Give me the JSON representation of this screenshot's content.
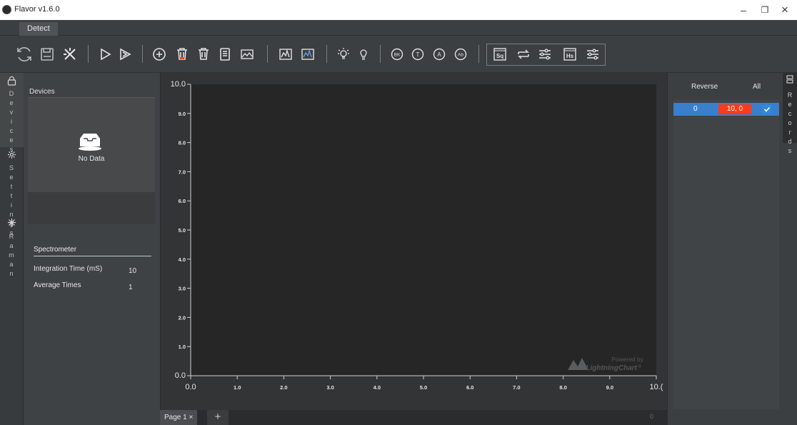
{
  "window": {
    "title": "Flavor v1.6.0",
    "minimize_glyph": "–",
    "restore_glyph": "❐",
    "close_glyph": "×"
  },
  "menu": {
    "tabs": [
      {
        "label": "Detect"
      }
    ]
  },
  "toolbar": {
    "icons": [
      "refresh-icon",
      "save-icon",
      "tools-icon",
      "play-icon",
      "play-outline-icon",
      "add-circle-icon",
      "delete-red-icon",
      "delete-icon",
      "document-icon",
      "image-icon",
      "spectrum-icon",
      "spectrum-filled-icon",
      "light-on-icon",
      "light-off-icon",
      "bk-icon",
      "t-icon",
      "a-icon",
      "ab-icon",
      "sq-icon",
      "swap-icon",
      "sliders-icon",
      "hs-icon",
      "sliders-icon-2"
    ],
    "badges": {
      "bk": "BK",
      "t": "T",
      "a": "A",
      "ab": "Ab",
      "sq": "Sq",
      "hs": "Hs"
    }
  },
  "left_tabs": [
    {
      "label": "Devices",
      "icon": "lock-icon"
    },
    {
      "label": "Settings",
      "icon": "gear-icon"
    },
    {
      "label": "Raman",
      "icon": "starburst-icon"
    }
  ],
  "devices": {
    "label": "Devices",
    "empty_text": "No Data"
  },
  "spectrometer": {
    "title": "Spectrometer",
    "rows": [
      {
        "label": "Integration Time  (mS)",
        "value": "10"
      },
      {
        "label": "Average Times",
        "value": "1"
      }
    ]
  },
  "chart_data": {
    "type": "line",
    "x": [],
    "series": [],
    "xlim": [
      0.0,
      10.0
    ],
    "ylim": [
      0.0,
      10.0
    ],
    "x_ticks": [
      "0.0",
      "1.0",
      "2.0",
      "3.0",
      "4.0",
      "5.0",
      "6.0",
      "7.0",
      "8.0",
      "9.0",
      "10.("
    ],
    "y_ticks": [
      "0.0",
      "1.0",
      "2.0",
      "3.0",
      "4.0",
      "5.0",
      "6.0",
      "7.0",
      "8.0",
      "9.0",
      "10.0"
    ],
    "grid": false,
    "watermark_line1": "Powered by",
    "watermark_line2": "LightningChart",
    "watermark_mark": "®"
  },
  "pages": {
    "tabs": [
      {
        "label": "Page 1",
        "close_glyph": "×"
      }
    ],
    "add_glyph": "+",
    "count": "0"
  },
  "records": {
    "tab_label": "Records",
    "header_reverse": "Reverse",
    "header_all": "All",
    "rows": [
      {
        "index": "0",
        "value": "10, 0",
        "checked": true
      }
    ]
  },
  "colors": {
    "accent_blue": "#3a7fcc",
    "value_red": "#ff3b1a",
    "plot_bg": "#262626",
    "panel_bg": "#3c3f41"
  }
}
